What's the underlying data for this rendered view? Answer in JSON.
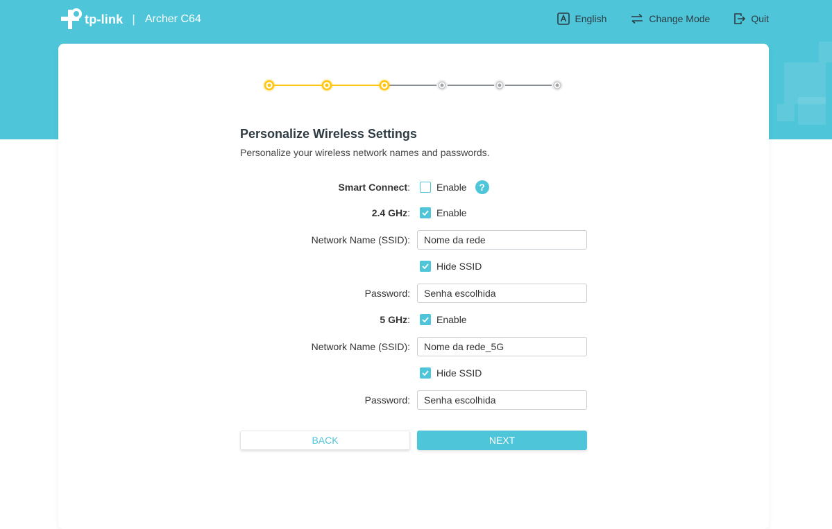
{
  "header": {
    "brand": "tp-link",
    "separator": "|",
    "model": "Archer C64",
    "nav": {
      "language_label": "English",
      "change_mode_label": "Change Mode",
      "quit_label": "Quit"
    }
  },
  "stepper": {
    "total_steps": 6,
    "completed_steps": 3,
    "active_color": "#ffc40d",
    "inactive_color": "#c8c8c8"
  },
  "page": {
    "title": "Personalize Wireless Settings",
    "subtitle": "Personalize your wireless network names and passwords."
  },
  "form": {
    "smart_connect": {
      "label": "Smart Connect",
      "colon": ":",
      "option": "Enable",
      "checked": false,
      "help_icon": "?"
    },
    "band_24": {
      "label": "2.4 GHz",
      "colon": ":",
      "option": "Enable",
      "checked": true,
      "ssid_label": "Network Name (SSID):",
      "ssid_value": "Nome da rede",
      "hide_ssid_label": "Hide SSID",
      "hide_ssid_checked": true,
      "password_label": "Password:",
      "password_value": "Senha escolhida"
    },
    "band_5": {
      "label": "5 GHz",
      "colon": ":",
      "option": "Enable",
      "checked": true,
      "ssid_label": "Network Name (SSID):",
      "ssid_value": "Nome da rede_5G",
      "hide_ssid_label": "Hide SSID",
      "hide_ssid_checked": true,
      "password_label": "Password:",
      "password_value": "Senha escolhida"
    }
  },
  "buttons": {
    "back": "BACK",
    "next": "NEXT"
  },
  "colors": {
    "accent": "#4ec5d8",
    "step_active": "#ffc40d"
  }
}
